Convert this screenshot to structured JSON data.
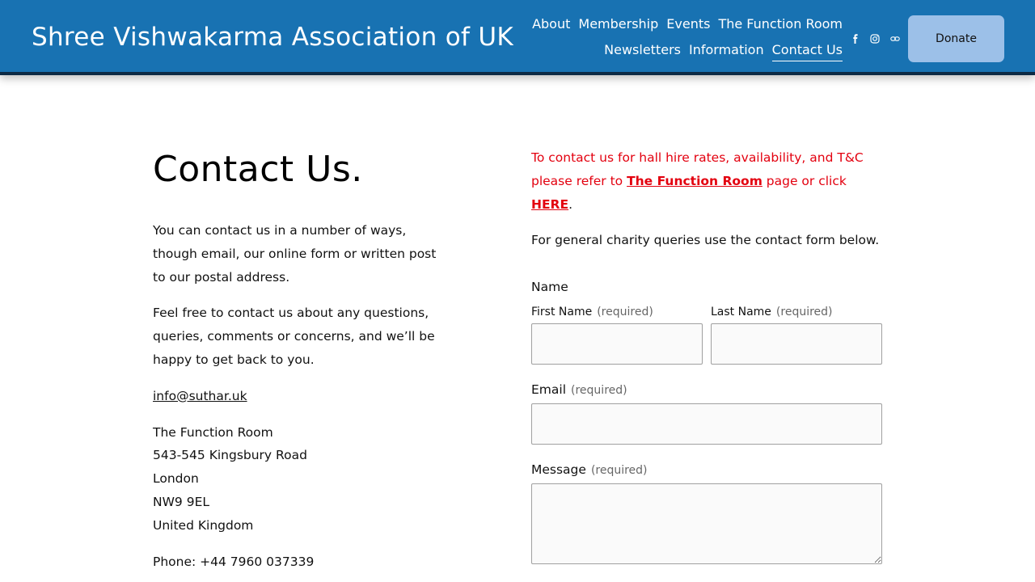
{
  "header": {
    "site_title": "Shree Vishwakarma Association of UK",
    "nav_row1": [
      "About",
      "Membership",
      "Events",
      "The Function Room"
    ],
    "nav_row2": [
      "Newsletters",
      "Information",
      "Contact Us"
    ],
    "active_nav": "Contact Us",
    "social_icons": [
      "facebook-icon",
      "instagram-icon",
      "link-icon"
    ],
    "donate_label": "Donate",
    "colors": {
      "header_bg": "#1872b2",
      "donate_bg": "#9cc0e8"
    }
  },
  "left": {
    "title": "Contact Us.",
    "para1": "You can contact us in a number of ways, though email, our online form or written post to our postal address.",
    "para2": "Feel free to contact us about any questions, queries, comments or concerns, and we’ll be happy to get back to you.",
    "email": "info@suthar.uk",
    "address": [
      "The Function Room",
      "543-545 Kingsbury Road",
      "London",
      "NW9 9EL",
      "United Kingdom"
    ],
    "phone": "Phone: +44 7960 037339"
  },
  "right": {
    "notice_text1": "To contact us for hall hire rates, availability, and T&C please refer to ",
    "notice_link1": "The Function Room",
    "notice_text2": " page or click ",
    "notice_link2": "HERE",
    "notice_end": ".",
    "notice_color": "#e3000f",
    "intro": "For general charity queries use the contact form below.",
    "form": {
      "name_legend": "Name",
      "first_name_label": "First Name",
      "last_name_label": "Last Name",
      "email_label": "Email",
      "message_label": "Message",
      "required_text": "(required)",
      "first_name_value": "",
      "last_name_value": "",
      "email_value": "",
      "message_value": ""
    }
  }
}
